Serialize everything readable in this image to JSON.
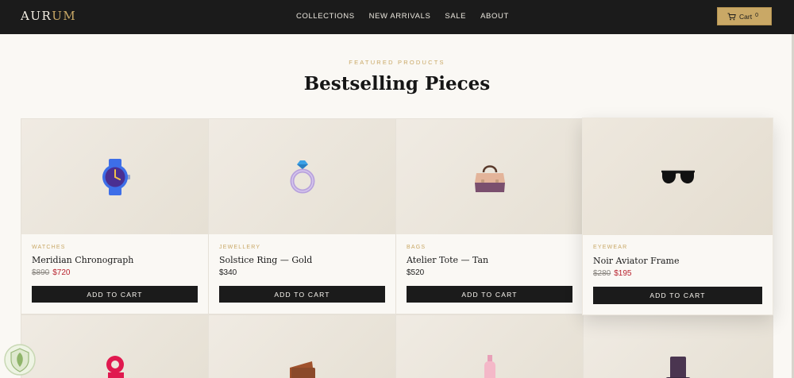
{
  "header": {
    "logo": {
      "part1": "AUR",
      "part2": "UM"
    },
    "nav": [
      "COLLECTIONS",
      "NEW ARRIVALS",
      "SALE",
      "ABOUT"
    ],
    "cart": {
      "label": "Cart",
      "count": "0"
    }
  },
  "section": {
    "eyebrow": "FEATURED PRODUCTS",
    "title": "Bestselling Pieces"
  },
  "products": [
    {
      "category": "WATCHES",
      "name": "Meridian Chronograph",
      "old_price": "$890",
      "price": "$720",
      "on_sale": true,
      "button": "ADD TO CART",
      "icon": "watch-icon"
    },
    {
      "category": "JEWELLERY",
      "name": "Solstice Ring — Gold",
      "price": "$340",
      "on_sale": false,
      "button": "ADD TO CART",
      "icon": "ring-icon"
    },
    {
      "category": "BAGS",
      "name": "Atelier Tote — Tan",
      "price": "$520",
      "on_sale": false,
      "button": "ADD TO CART",
      "icon": "handbag-icon"
    },
    {
      "category": "EYEWEAR",
      "name": "Noir Aviator Frame",
      "old_price": "$280",
      "price": "$195",
      "on_sale": true,
      "button": "ADD TO CART",
      "icon": "sunglasses-icon"
    }
  ],
  "colors": {
    "accent": "#c9a866",
    "header_bg": "#1b1b1b",
    "sale": "#b8232f",
    "page_bg": "#faf8f4"
  }
}
